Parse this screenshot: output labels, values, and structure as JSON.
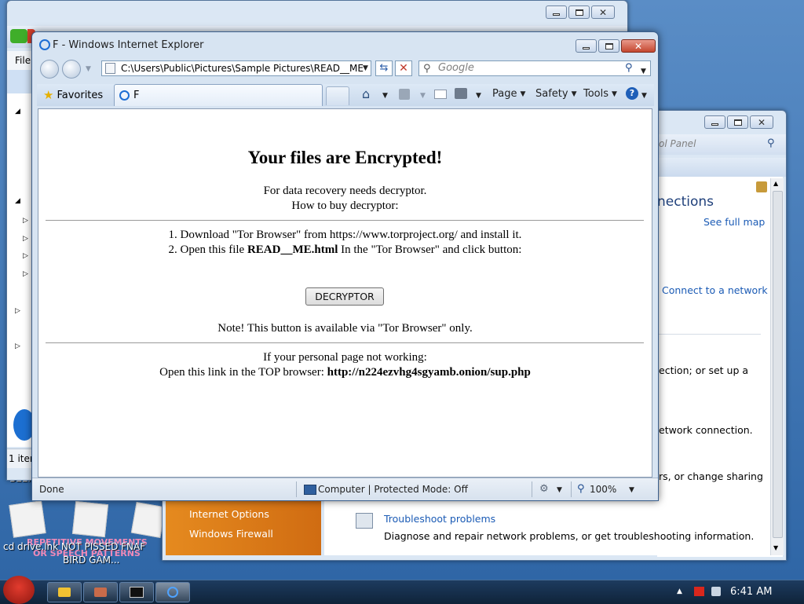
{
  "desktop": {
    "caption_line1": "BEEF",
    "caption_line2": "cd drive.lnk  NOT PISSED    FNAF",
    "caption_line3": "BIRD GAM...",
    "pink_text1": "REPETITIVE MOVEMENTS",
    "pink_text2": "OR SPEECH PATTERNS"
  },
  "back_explorer": {
    "menu_file": "File",
    "status_items": "1 item"
  },
  "back_network": {
    "search_placeholder": "ol Panel",
    "heading": "nections",
    "see_full_map": "See full map",
    "connect_link": "Connect to a network",
    "setup_text": "ection; or set up a",
    "network_conn_text": "etwork connection.",
    "sharing_text": "rs, or change sharing",
    "sidebar_internet_options": "Internet Options",
    "sidebar_windows_firewall": "Windows Firewall",
    "troubleshoot_link": "Troubleshoot problems",
    "troubleshoot_desc": "Diagnose and repair network problems, or get troubleshooting information."
  },
  "ie": {
    "title": "F - Windows Internet Explorer",
    "address": "C:\\Users\\Public\\Pictures\\Sample Pictures\\READ__ME",
    "search_placeholder": "Google",
    "favorites_label": "Favorites",
    "tab_label": "F",
    "toolbar": {
      "page": "Page",
      "safety": "Safety",
      "tools": "Tools"
    },
    "status": {
      "done": "Done",
      "zone": "Computer | Protected Mode: Off",
      "zoom": "100%"
    }
  },
  "ransom_page": {
    "heading": "Your files are Encrypted!",
    "line1": "For data recovery needs decryptor.",
    "line2": "How to buy decryptor:",
    "step1": "1. Download \"Tor Browser\" from https://www.torproject.org/ and install it.",
    "step2_prefix": "2. Open this file ",
    "step2_file": "READ__ME.html",
    "step2_suffix": " In the \"Tor Browser\" and click button:",
    "button_label": "DECRYPTOR",
    "note": "Note! This button is available via \"Tor Browser\" only.",
    "fallback1": "If your personal page not working:",
    "fallback2_prefix": "Open this link in the TOP browser: ",
    "fallback2_link": "http://n224ezvhg4sgyamb.onion/sup.php"
  },
  "taskbar": {
    "clock": "6:41 AM"
  },
  "colors": {
    "link": "#1b5bb5",
    "taskbar": "#0f2339",
    "close_button": "#c4472f"
  }
}
